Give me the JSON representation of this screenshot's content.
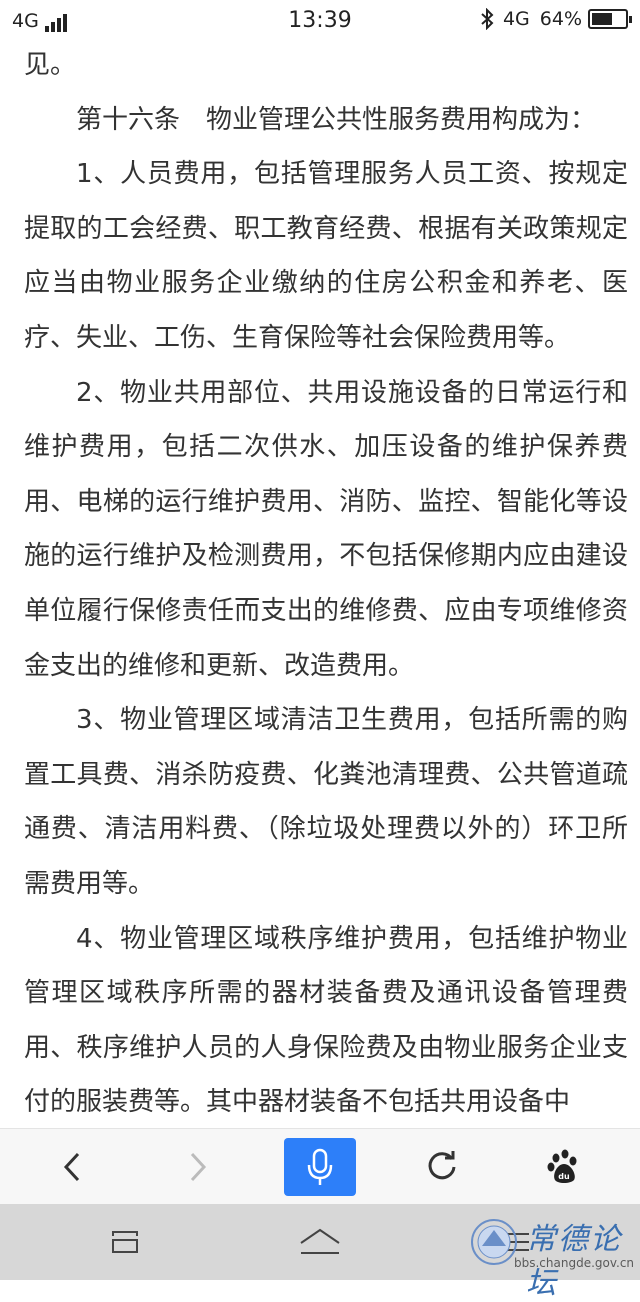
{
  "status_bar": {
    "network_left": "4G",
    "time": "13:39",
    "network_right": "4G",
    "battery_percent_label": "64%",
    "battery_level": 0.64,
    "icons": [
      "signal-bars-icon",
      "bluetooth-icon",
      "battery-icon"
    ]
  },
  "article": {
    "paragraphs": [
      "见。",
      "第十六条　物业管理公共性服务费用构成为：",
      "1、人员费用，包括管理服务人员工资、按规定提取的工会经费、职工教育经费、根据有关政策规定应当由物业服务企业缴纳的住房公积金和养老、医疗、失业、工伤、生育保险等社会保险费用等。",
      "2、物业共用部位、共用设施设备的日常运行和维护费用，包括二次供水、加压设备的维护保养费用、电梯的运行维护费用、消防、监控、智能化等设施的运行维护及检测费用，不包括保修期内应由建设单位履行保修责任而支出的维修费、应由专项维修资金支出的维修和更新、改造费用。",
      "3、物业管理区域清洁卫生费用，包括所需的购置工具费、消杀防疫费、化粪池清理费、公共管道疏通费、清洁用料费、（除垃圾处理费以外的）环卫所需费用等。",
      "4、物业管理区域秩序维护费用，包括维护物业管理区域秩序所需的器材装备费及通讯设备管理费用、秩序维护人员的人身保险费及由物业服务企业支付的服装费等。其中器材装备不包括共用设备中"
    ]
  },
  "browser_toolbar": {
    "icons": [
      "back-icon",
      "forward-icon",
      "microphone-icon",
      "refresh-icon",
      "baidu-paw-icon"
    ],
    "accent_color": "#2d7ff9"
  },
  "nav_bar": {
    "icons": [
      "recent-apps-icon",
      "home-icon",
      "menu-icon"
    ]
  },
  "watermark": {
    "title": "常德论坛",
    "url": "bbs.changde.gov.cn"
  },
  "colors": {
    "text": "#333333",
    "background": "#ffffff",
    "toolbar_bg": "#f7f7f7",
    "navbar_bg": "#d7d7d7"
  }
}
